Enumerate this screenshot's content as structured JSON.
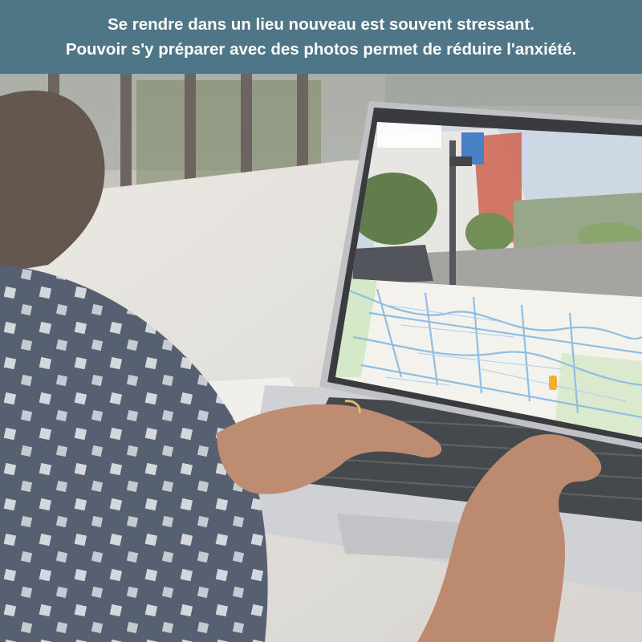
{
  "caption": {
    "line1": "Se rendre dans un lieu nouveau est souvent stressant.",
    "line2": "Pouvoir s'y préparer avec des photos permet de réduire l'anxiété."
  },
  "photo": {
    "subject": "person-typing-on-laptop-showing-street-view-and-map",
    "colors": {
      "banner": "#4f7687",
      "shirt": "#3f4a5e",
      "shirt_pattern": "#cfd3d9",
      "map_water": "#7fb7e0",
      "map_green": "#cfe6c0",
      "laptop": "#c9cbcf"
    }
  }
}
